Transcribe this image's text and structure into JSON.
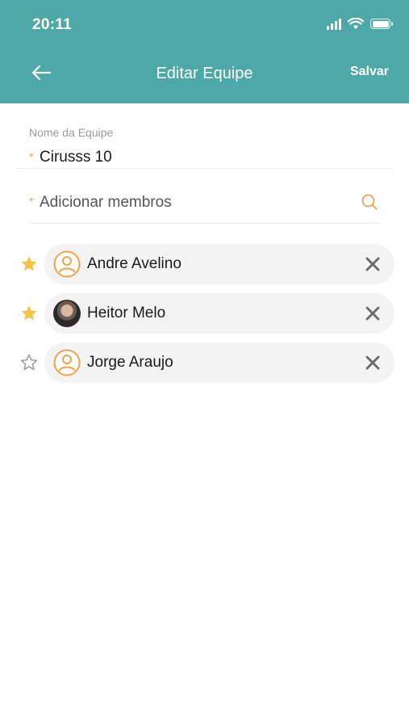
{
  "status_bar": {
    "time": "20:11"
  },
  "header": {
    "title": "Editar Equipe",
    "save_label": "Salvar"
  },
  "form": {
    "team_name_label": "Nome da Equipe",
    "required_mark": "*",
    "team_name_value": "Cirusss 10",
    "members_placeholder": "Adicionar membros"
  },
  "members": [
    {
      "name": "Andre Avelino",
      "starred": true,
      "avatar": "placeholder-user-icon"
    },
    {
      "name": "Heitor Melo",
      "starred": true,
      "avatar": "photo"
    },
    {
      "name": "Jorge Araujo",
      "starred": false,
      "avatar": "placeholder-user-icon"
    }
  ],
  "colors": {
    "header": "#4ea8a8",
    "accent": "#f0a14e",
    "star_filled": "#f5c242",
    "star_empty": "#9a9a9a",
    "remove": "#6a6a6a"
  }
}
